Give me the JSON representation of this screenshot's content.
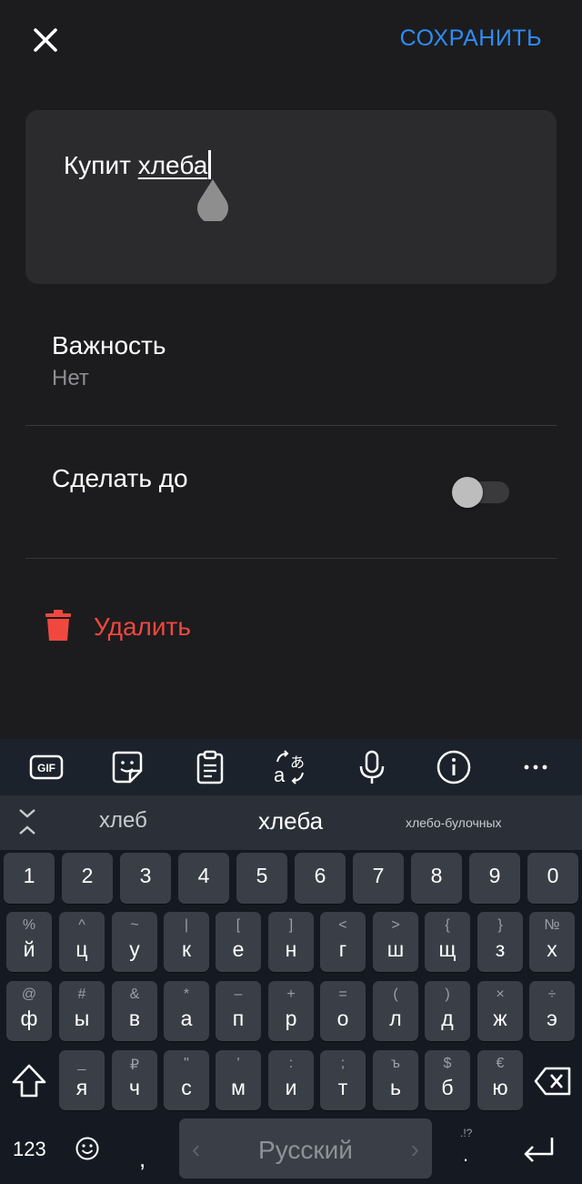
{
  "header": {
    "close_icon": "close-icon",
    "save_label": "СОХРАНИТЬ",
    "accent": "#2f8cf5"
  },
  "task": {
    "prefix": "Купит ",
    "word": "хлеба"
  },
  "importance": {
    "title": "Важность",
    "value": "Нет"
  },
  "deadline": {
    "title": "Сделать до",
    "enabled": false
  },
  "delete": {
    "label": "Удалить",
    "color": "#f0483e"
  },
  "keyboard": {
    "toolbar": {
      "gif": "GIF",
      "icons": [
        "gif-icon",
        "sticker-icon",
        "clipboard-icon",
        "translate-icon",
        "microphone-icon",
        "info-icon",
        "more-icon"
      ]
    },
    "suggestions": [
      "хлеб",
      "хлеба",
      "хлебо-булочных"
    ],
    "digits": [
      "1",
      "2",
      "3",
      "4",
      "5",
      "6",
      "7",
      "8",
      "9",
      "0"
    ],
    "row1": {
      "main": [
        "й",
        "ц",
        "у",
        "к",
        "е",
        "н",
        "г",
        "ш",
        "щ",
        "з",
        "х"
      ],
      "alt": [
        "%",
        "^",
        "~",
        "|",
        "[",
        "]",
        "<",
        ">",
        "{",
        "}",
        "№"
      ]
    },
    "row2": {
      "main": [
        "ф",
        "ы",
        "в",
        "а",
        "п",
        "р",
        "о",
        "л",
        "д",
        "ж",
        "э"
      ],
      "alt": [
        "@",
        "#",
        "&",
        "*",
        "–",
        "+",
        "=",
        "(",
        ")",
        "×",
        "÷"
      ]
    },
    "row3": {
      "main": [
        "я",
        "ч",
        "с",
        "м",
        "и",
        "т",
        "ь",
        "б",
        "ю"
      ],
      "alt": [
        "_",
        "₽",
        "\"",
        "'",
        ":",
        ";",
        "ъ",
        "$",
        "€"
      ]
    },
    "bottom": {
      "symbols": "123",
      "comma": ",",
      "space": "Русский",
      "punct_alt": ".!?",
      "period": "."
    }
  }
}
